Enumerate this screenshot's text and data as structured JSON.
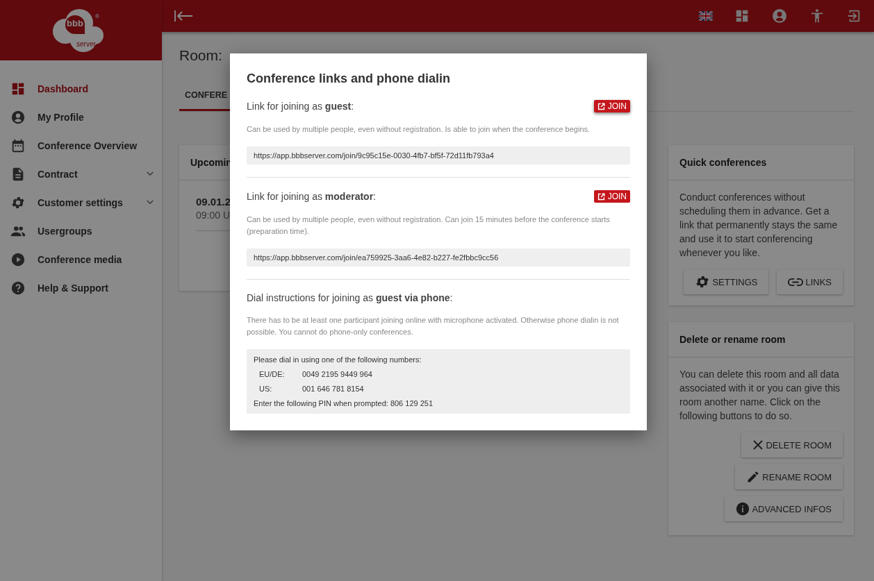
{
  "logo": {
    "mark": "bbb",
    "subtitle": "server",
    "registered": "®"
  },
  "sidebar": {
    "items": [
      {
        "label": "Dashboard",
        "kind": "dashboard",
        "selected": true,
        "expandable": false
      },
      {
        "label": "My Profile",
        "kind": "profile",
        "selected": false,
        "expandable": false
      },
      {
        "label": "Conference Overview",
        "kind": "calendar",
        "selected": false,
        "expandable": false
      },
      {
        "label": "Contract",
        "kind": "document",
        "selected": false,
        "expandable": true
      },
      {
        "label": "Customer settings",
        "kind": "gear",
        "selected": false,
        "expandable": true
      },
      {
        "label": "Usergroups",
        "kind": "group",
        "selected": false,
        "expandable": false
      },
      {
        "label": "Conference media",
        "kind": "play",
        "selected": false,
        "expandable": false
      },
      {
        "label": "Help & Support",
        "kind": "help",
        "selected": false,
        "expandable": false
      }
    ]
  },
  "page": {
    "title": "Room:",
    "tabs": [
      {
        "label": "CONFERE",
        "selected": true
      }
    ],
    "upcoming": {
      "title": "Upcomin",
      "date": "09.01.2",
      "time": "09:00 U"
    },
    "cards": [
      {
        "title": "Quick conferences",
        "text": "Conduct conferences without scheduling them in advance. Get a link that permanently stays the same and use it to start conferencing whenever you like.",
        "buttons": [
          {
            "label": "SETTINGS",
            "kind": "settings"
          },
          {
            "label": "LINKS",
            "kind": "link"
          }
        ]
      },
      {
        "title": "Delete or rename room",
        "text": "You can delete this room and all data associated with it or you can give this room another name. Click on the following buttons to do so.",
        "buttons": [
          {
            "label": "DELETE ROOM",
            "kind": "delete"
          },
          {
            "label": "RENAME ROOM",
            "kind": "rename"
          },
          {
            "label": "ADVANCED INFOS",
            "kind": "info"
          }
        ]
      }
    ]
  },
  "dialog": {
    "title": "Conference links and phone dialin",
    "sections": [
      {
        "kind": "link",
        "label": "Link for joining as **guest**:",
        "join": "JOIN",
        "raised": true,
        "note": "Can be used by multiple people, even without registration. Is able to join when the conference begins.",
        "url": "https://app.bbbserver.com/join/9c95c15e-0030-4fb7-bf5f-72d11fb793a4"
      },
      {
        "kind": "link",
        "label": "Link for joining as **moderator**:",
        "join": "JOIN",
        "raised": false,
        "note": "Can be used by multiple people, even without registration. Can join 15 minutes before the conference starts (preparation time).",
        "url": "https://app.bbbserver.com/join/ea759925-3aa6-4e82-b227-fe2fbbc9cc56"
      },
      {
        "kind": "phone",
        "label": "Dial instructions for joining as **guest via phone**:",
        "note": "There has to be at least one participant joining online with microphone activated. Otherwise phone dialin is not possible. You cannot do phone-only conferences.",
        "intro": "Please dial in using one of the following numbers:",
        "numbers": [
          {
            "region": "EU/DE:",
            "number": "0049 2195 9449 964"
          },
          {
            "region": "US:",
            "number": "001 646 781 8154"
          }
        ],
        "pin": "Enter the following PIN when prompted: 806 129 251"
      }
    ]
  }
}
